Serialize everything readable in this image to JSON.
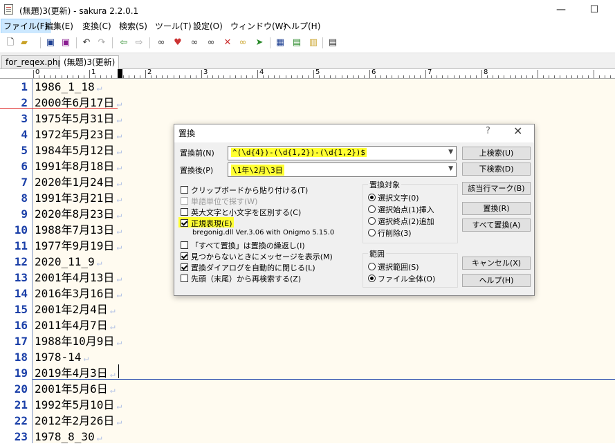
{
  "window": {
    "title": "(無題)3(更新) - sakura 2.2.0.1",
    "minimize": "—",
    "maximize": "☐"
  },
  "menu": [
    "ファイル(F)",
    "編集(E)",
    "変換(C)",
    "検索(S)",
    "ツール(T)",
    "設定(O)",
    "ウィンドウ(W)",
    "ヘルプ(H)"
  ],
  "toolbar_icons": [
    "new-file-icon",
    "open-file-icon",
    "save-icon",
    "save-all-icon",
    "undo-icon",
    "redo-icon",
    "jump-back-icon",
    "jump-forward-icon",
    "search-icon",
    "search-prev-icon",
    "search-next-icon",
    "replace-icon",
    "find-mark-icon",
    "grep-icon",
    "outline-icon",
    "compare-icon",
    "grep-replace-icon",
    "settings-icon"
  ],
  "tabs": [
    "for_reqex.php",
    "(無題)3(更新)"
  ],
  "ruler_labels": [
    "0",
    "1",
    "2",
    "3",
    "4",
    "5",
    "6",
    "7",
    "8"
  ],
  "lines": [
    {
      "n": "1",
      "t": "1986_1_18"
    },
    {
      "n": "2",
      "t": "2000年6月17日"
    },
    {
      "n": "3",
      "t": "1975年5月31日"
    },
    {
      "n": "4",
      "t": "1972年5月23日"
    },
    {
      "n": "5",
      "t": "1984年5月12日"
    },
    {
      "n": "6",
      "t": "1991年8月18日"
    },
    {
      "n": "7",
      "t": "2020年1月24日"
    },
    {
      "n": "8",
      "t": "1991年3月21日"
    },
    {
      "n": "9",
      "t": "2020年8月23日"
    },
    {
      "n": "10",
      "t": "1988年7月13日"
    },
    {
      "n": "11",
      "t": "1977年9月19日"
    },
    {
      "n": "12",
      "t": "2020_11_9"
    },
    {
      "n": "13",
      "t": "2001年4月13日"
    },
    {
      "n": "14",
      "t": "2016年3月16日"
    },
    {
      "n": "15",
      "t": "2001年2月4日"
    },
    {
      "n": "16",
      "t": "2011年4月7日"
    },
    {
      "n": "17",
      "t": "1988年10月9日"
    },
    {
      "n": "18",
      "t": "1978-14"
    },
    {
      "n": "19",
      "t": "2019年4月3日"
    },
    {
      "n": "20",
      "t": "2001年5月6日"
    },
    {
      "n": "21",
      "t": "1992年5月10日"
    },
    {
      "n": "22",
      "t": "2012年2月26日"
    },
    {
      "n": "23",
      "t": "1978_8_30"
    }
  ],
  "dialog": {
    "title": "置換",
    "help": "?",
    "close": "✕",
    "find_label": "置換前(N)",
    "find_value": "^(\\d{4})-(\\d{1,2})-(\\d{1,2})$",
    "replace_label": "置換後(P)",
    "replace_value": "\\1年\\2月\\3日",
    "options": {
      "clipboard": "クリップボードから貼り付ける(T)",
      "word": "単語単位で探す(W)",
      "case": "英大文字と小文字を区別する(C)",
      "regex": "正規表現(E)",
      "regex_lib": "bregonig.dll Ver.3.06 with Onigmo 5.15.0",
      "repeat": "「すべて置換」は置換の繰返し(I)",
      "notfound": "見つからないときにメッセージを表示(M)",
      "autoclose": "置換ダイアログを自動的に閉じる(L)",
      "wrap": "先頭（末尾）から再検索する(Z)"
    },
    "target_group": "置換対象",
    "targets": [
      "選択文字(0)",
      "選択始点(1)挿入",
      "選択終点(2)追加",
      "行削除(3)"
    ],
    "range_group": "範囲",
    "ranges": [
      "選択範囲(S)",
      "ファイル全体(O)"
    ],
    "buttons": {
      "up": "上検索(U)",
      "down": "下検索(D)",
      "mark": "該当行マーク(B)",
      "replace": "置換(R)",
      "replace_all": "すべて置換(A)",
      "cancel": "キャンセル(X)",
      "help": "ヘルプ(H)"
    }
  }
}
